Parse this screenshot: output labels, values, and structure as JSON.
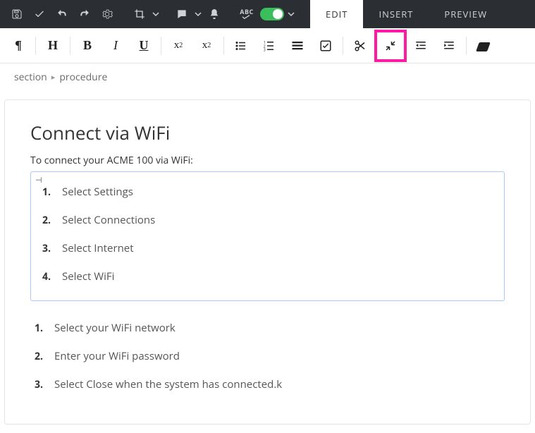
{
  "tabs": {
    "edit": "EDIT",
    "insert": "INSERT",
    "preview": "PREVIEW"
  },
  "breadcrumb": {
    "section": "section",
    "procedure": "procedure"
  },
  "article": {
    "title": "Connect via WiFi",
    "intro": "To connect your ACME 100 via WiFi:",
    "boxed_steps": [
      "Select Settings",
      "Select Connections",
      "Select Internet",
      "Select WiFi"
    ],
    "more_steps": [
      "Select your WiFi network",
      "Enter your WiFi password",
      "Select Close when the system has connected.k"
    ]
  },
  "toolbar": {
    "pilcrow": "¶",
    "heading": "H",
    "bold": "B",
    "italic": "I",
    "underline": "U",
    "sup": "x²",
    "sub": "x₂"
  }
}
